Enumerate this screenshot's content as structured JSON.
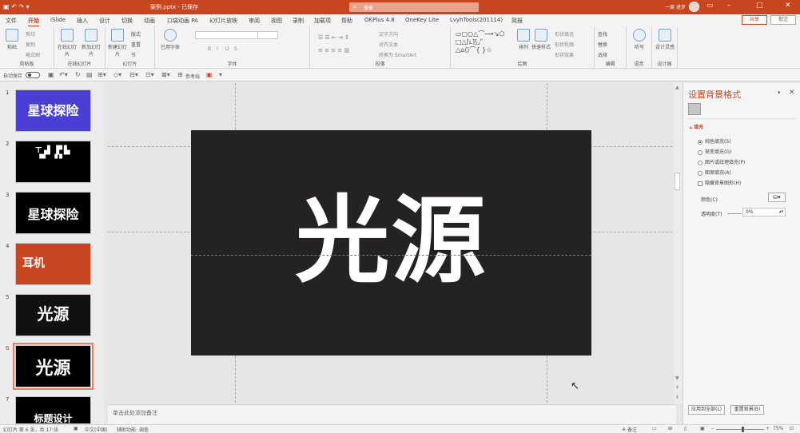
{
  "title_bar": {
    "app_icon": "autosave-icon",
    "file_name": "案例.pptx - 已保存",
    "search_placeholder": "搜索",
    "user_name": "一周 进步",
    "icons": [
      "ribbon-display-icon",
      "minimize-icon",
      "maximize-icon",
      "close-icon"
    ]
  },
  "menu": {
    "tabs": [
      "文件",
      "开始",
      "iSlide",
      "插入",
      "设计",
      "切换",
      "动画",
      "口袋动画 PA",
      "幻灯片放映",
      "审阅",
      "视图",
      "录制",
      "加载项",
      "帮助",
      "OKPlus 4.8",
      "OneKey Lite",
      "LvyhTools(201114)",
      "简报"
    ],
    "active": "开始",
    "share_label": "共享",
    "comment_label": "批注"
  },
  "ribbon": {
    "groups": [
      {
        "label": "剪贴板",
        "buttons": [
          "粘贴"
        ],
        "small": [
          "剪切",
          "复制",
          "格式刷"
        ]
      },
      {
        "label": "在线幻灯片",
        "buttons": [
          "在线幻灯片",
          "新加幻灯片"
        ]
      },
      {
        "label": "幻灯片",
        "buttons": [
          "新建幻灯片"
        ],
        "small": [
          "版式",
          "重置",
          "节"
        ]
      },
      {
        "label": "字体",
        "buttons": [
          "已用字体"
        ],
        "small": [
          "B",
          "I",
          "U",
          "S"
        ]
      },
      {
        "label": "段落",
        "small": [
          "文字方向",
          "对齐文本",
          "转换为 SmartArt"
        ]
      },
      {
        "label": "绘图",
        "buttons": [
          "排列",
          "快速样式"
        ],
        "small": [
          "形状填充",
          "形状轮廓",
          "形状效果"
        ]
      },
      {
        "label": "编辑",
        "small": [
          "查找",
          "替换",
          "选择"
        ]
      },
      {
        "label": "语音",
        "buttons": [
          "听写"
        ]
      },
      {
        "label": "设计器",
        "buttons": [
          "设计灵感"
        ]
      }
    ]
  },
  "quick_access": {
    "autosave_label": "自动保存",
    "autosave_state": "关",
    "extra_label": "参考线"
  },
  "slides": [
    {
      "num": "1",
      "title": "星球探险",
      "bg": "#4a3fd4"
    },
    {
      "num": "2",
      "title": "",
      "bg": "#000000"
    },
    {
      "num": "3",
      "title": "星球探险",
      "bg": "#000000"
    },
    {
      "num": "4",
      "title": "耳机",
      "bg": "#c8461f"
    },
    {
      "num": "5",
      "title": "光源",
      "bg": "#111111"
    },
    {
      "num": "6",
      "title": "光源",
      "bg": "#000000"
    },
    {
      "num": "7",
      "title": "标题设计",
      "bg": "#000000"
    }
  ],
  "selected_slide": "6",
  "current_slide": {
    "title": "光源",
    "bg": "#252222"
  },
  "notes_placeholder": "单击此处添加备注",
  "format_pane": {
    "title": "设置背景格式",
    "fill_header": "填充",
    "options": [
      {
        "label": "纯色填充(S)",
        "checked": true
      },
      {
        "label": "渐变填充(G)",
        "checked": false
      },
      {
        "label": "图片或纹理填充(P)",
        "checked": false
      },
      {
        "label": "图案填充(A)",
        "checked": false
      }
    ],
    "hide_bg_label": "隐藏背景图形(H)",
    "color_label": "颜色(C)",
    "transparency_label": "透明度(T)",
    "transparency_value": "0%",
    "apply_all_label": "应用到全部(L)",
    "reset_label": "重置背景(B)"
  },
  "status_bar": {
    "slide_info": "幻灯片 第 6 张，共 17 张",
    "language": "中文(中国)",
    "accessibility": "辅助功能: 调查",
    "notes_btn": "备注",
    "zoom": "75%"
  }
}
